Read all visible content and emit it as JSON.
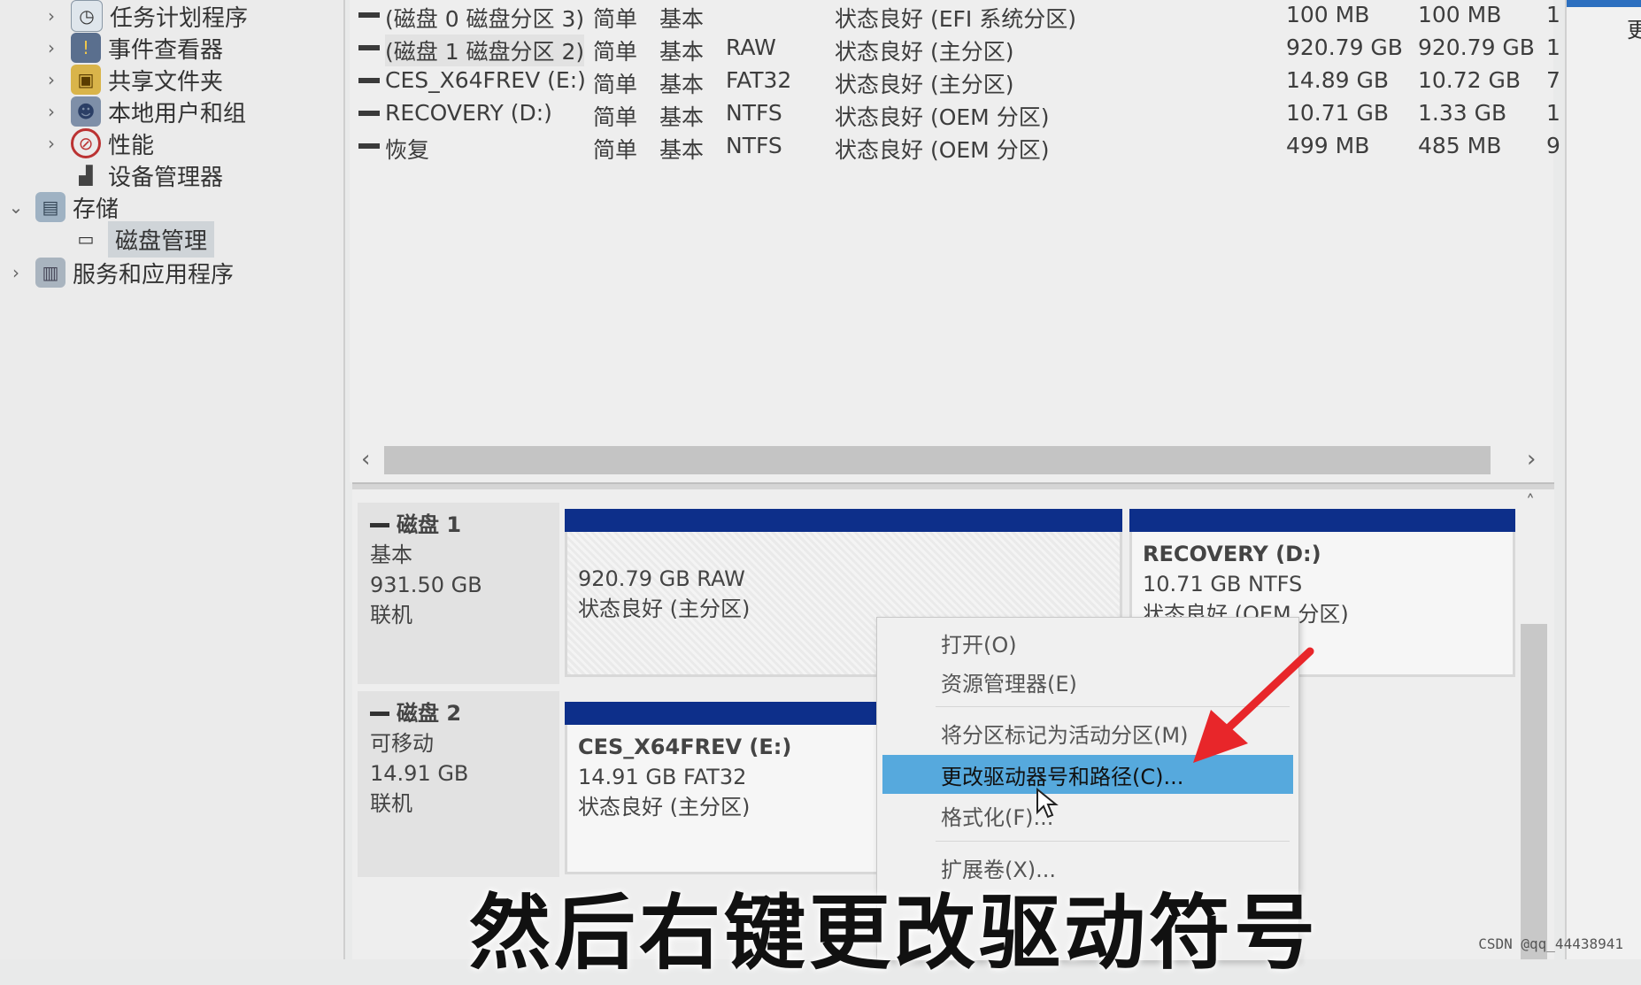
{
  "tree": {
    "items": [
      {
        "label": "任务计划程序",
        "icon": "clock-icon",
        "chevron": "›"
      },
      {
        "label": "事件查看器",
        "icon": "event-viewer-icon",
        "chevron": "›"
      },
      {
        "label": "共享文件夹",
        "icon": "shared-folder-icon",
        "chevron": "›"
      },
      {
        "label": "本地用户和组",
        "icon": "users-icon",
        "chevron": "›"
      },
      {
        "label": "性能",
        "icon": "performance-icon",
        "chevron": "›"
      },
      {
        "label": "设备管理器",
        "icon": "device-manager-icon",
        "chevron": ""
      },
      {
        "label": "存储",
        "icon": "storage-icon",
        "chevron": "⌄"
      },
      {
        "label": "磁盘管理",
        "icon": "disk-management-icon",
        "chevron": ""
      },
      {
        "label": "服务和应用程序",
        "icon": "services-icon",
        "chevron": "›"
      }
    ]
  },
  "volumes": {
    "rows": [
      {
        "name": "(磁盘 0 磁盘分区 3)",
        "layout": "简单",
        "type": "基本",
        "fs": "",
        "status": "状态良好 (EFI 系统分区)",
        "capacity": "100 MB",
        "free": "100 MB",
        "pct": "1"
      },
      {
        "name": "(磁盘 1 磁盘分区 2)",
        "layout": "简单",
        "type": "基本",
        "fs": "RAW",
        "status": "状态良好 (主分区)",
        "capacity": "920.79 GB",
        "free": "920.79 GB",
        "pct": "1"
      },
      {
        "name": "CES_X64FREV (E:)",
        "layout": "简单",
        "type": "基本",
        "fs": "FAT32",
        "status": "状态良好 (主分区)",
        "capacity": "14.89 GB",
        "free": "10.72 GB",
        "pct": "7"
      },
      {
        "name": "RECOVERY (D:)",
        "layout": "简单",
        "type": "基本",
        "fs": "NTFS",
        "status": "状态良好 (OEM 分区)",
        "capacity": "10.71 GB",
        "free": "1.33 GB",
        "pct": "1"
      },
      {
        "name": "恢复",
        "layout": "简单",
        "type": "基本",
        "fs": "NTFS",
        "status": "状态良好 (OEM 分区)",
        "capacity": "499 MB",
        "free": "485 MB",
        "pct": "9"
      }
    ]
  },
  "scroll": {
    "left": "‹",
    "right": "›",
    "up": "˄"
  },
  "disks": [
    {
      "name": "磁盘 1",
      "type": "基本",
      "size": "931.50 GB",
      "state": "联机"
    },
    {
      "name": "磁盘 2",
      "type": "可移动",
      "size": "14.91 GB",
      "state": "联机"
    }
  ],
  "partitions": {
    "disk1_raw": {
      "title": "",
      "line1": "920.79 GB RAW",
      "line2": "状态良好 (主分区)"
    },
    "disk1_recovery": {
      "title": "RECOVERY  (D:)",
      "line1": "10.71 GB NTFS",
      "line2": "状态良好 (OEM 分区)"
    },
    "disk2_ces": {
      "title": "CES_X64FREV  (E:)",
      "line1": "14.91 GB FAT32",
      "line2": "状态良好 (主分区)"
    }
  },
  "context_menu": {
    "items": [
      {
        "label": "打开(O)"
      },
      {
        "label": "资源管理器(E)"
      },
      {
        "label": "将分区标记为活动分区(M)"
      },
      {
        "label": "更改驱动器号和路径(C)..."
      },
      {
        "label": "格式化(F)..."
      },
      {
        "label": "扩展卷(X)..."
      }
    ]
  },
  "right_pane": {
    "text": "更"
  },
  "caption": "然后右键更改驱动符号",
  "watermark": "CSDN @qq_44438941",
  "colors": {
    "partition_bar": "#0d2f8a",
    "menu_highlight": "#56a9dd",
    "arrow": "#e8262a"
  }
}
